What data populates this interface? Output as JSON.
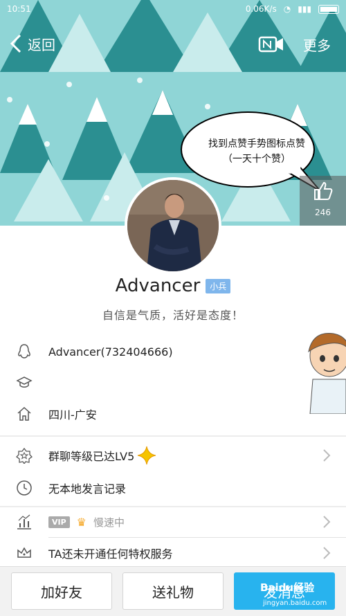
{
  "status_bar": {
    "time": "10:51",
    "speed": "0.06K/s"
  },
  "header": {
    "back_label": "返回",
    "more_label": "更多"
  },
  "bubble_text": "找到点赞手势图标点赞（一天十个赞）",
  "likes": {
    "count": "246"
  },
  "profile": {
    "name": "Advancer",
    "badge": "小兵",
    "signature": "自信是气质，活好是态度！"
  },
  "info_rows": [
    {
      "icon": "penguin-icon",
      "text": "Advancer(732404666)"
    },
    {
      "icon": "graduation-cap-icon",
      "text": ""
    },
    {
      "icon": "home-icon",
      "text": "四川-广安"
    }
  ],
  "activity_rows": [
    {
      "icon": "star-badge-icon",
      "text": "群聊等级已达LV5"
    },
    {
      "icon": "clock-icon",
      "text": "无本地发言记录"
    }
  ],
  "privilege_rows": [
    {
      "icon": "chart-icon",
      "vip": "VIP",
      "speed": "慢速中"
    },
    {
      "icon": "crown-outline-icon",
      "text": "TA还未开通任何特权服务"
    }
  ],
  "bottom_buttons": {
    "add_friend": "加好友",
    "send_gift": "送礼物",
    "send_message": "发消息"
  },
  "watermark": {
    "brand": "Baidu经验",
    "url": "jingyan.baidu.com"
  },
  "colors": {
    "sky": "#8fd5d6",
    "tree_dark": "#2b8f91",
    "tree_light": "#c9ecec",
    "accent": "#28b3ee",
    "badge": "#7fb6ec"
  }
}
